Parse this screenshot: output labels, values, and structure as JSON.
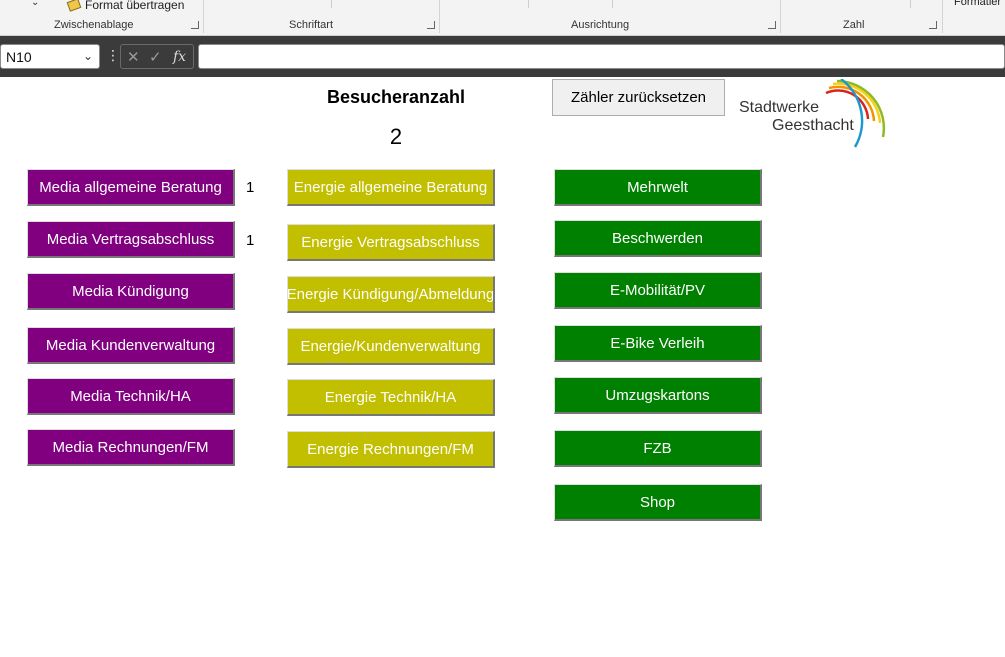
{
  "ribbon": {
    "format_painter": "Format übertragen",
    "formatier_cut": "Formatier",
    "groups": [
      "Zwischenablage",
      "Schriftart",
      "Ausrichtung",
      "Zahl"
    ]
  },
  "formula_bar": {
    "name_box": "N10",
    "formula": ""
  },
  "sheet": {
    "title": "Besucheranzahl",
    "count": "2",
    "reset_button": "Zähler zurücksetzen",
    "logo": {
      "line1": "Stadtwerke",
      "line2": "Geesthacht",
      "arc_colors": [
        "#d9241c",
        "#f29400",
        "#f7d117",
        "#8dbb25",
        "#1d98cf"
      ]
    },
    "media_buttons": [
      "Media allgemeine Beratung",
      "Media Vertragsabschluss",
      "Media Kündigung",
      "Media Kundenverwaltung",
      "Media Technik/HA",
      "Media Rechnungen/FM"
    ],
    "media_counts": [
      "1",
      "1"
    ],
    "energie_buttons": [
      "Energie allgemeine Beratung",
      "Energie Vertragsabschluss",
      "Energie Kündigung/Abmeldung",
      "Energie/Kundenverwaltung",
      "Energie Technik/HA",
      "Energie Rechnungen/FM"
    ],
    "green_buttons": [
      "Mehrwelt",
      "Beschwerden",
      "E-Mobilität/PV",
      "E-Bike Verleih",
      "Umzugskartons",
      "FZB",
      "Shop"
    ],
    "colors": {
      "media": "#800080",
      "energie": "#c2bf00",
      "green": "#008000"
    }
  }
}
